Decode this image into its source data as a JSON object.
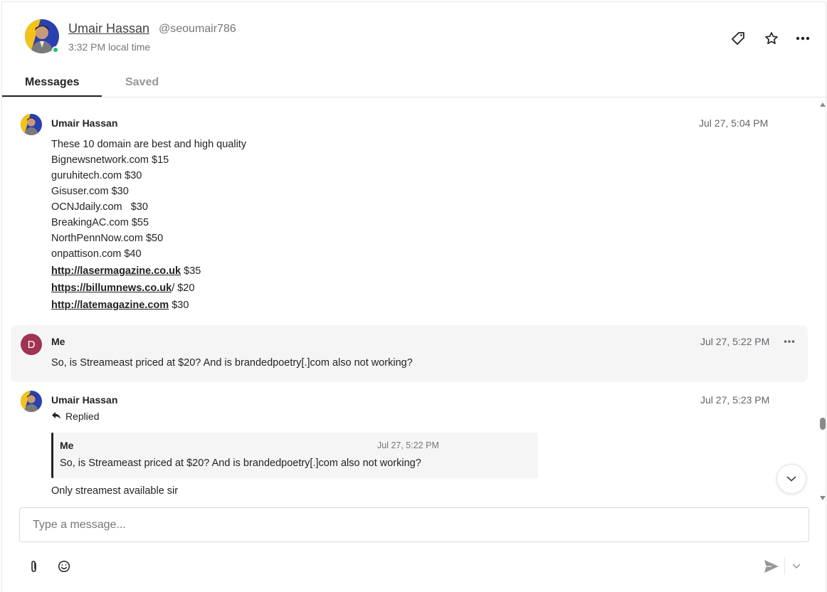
{
  "header": {
    "name": "Umair Hassan",
    "handle": "@seoumair786",
    "local_time": "3:32 PM local time"
  },
  "tabs": [
    {
      "label": "Messages",
      "active": true
    },
    {
      "label": "Saved",
      "active": false
    }
  ],
  "messages": [
    {
      "sender": "Umair Hassan",
      "time": "Jul 27, 5:04 PM",
      "lines": [
        "These 10 domain are best and high quality",
        "Bignewsnetwork.com $15",
        "guruhitech.com $30",
        "Gisuser.com $30",
        "OCNJdaily.com   $30",
        "BreakingAC.com $55",
        "NorthPennNow.com $50",
        "onpattison.com $40"
      ],
      "link_lines": [
        {
          "link": "http://lasermagazine.co.uk",
          "suffix": " $35"
        },
        {
          "link": "https://billumnews.co.uk",
          "suffix": "/ $20"
        },
        {
          "link": "http://latemagazine.com",
          "suffix": " $30"
        }
      ]
    },
    {
      "sender": "Me",
      "avatar_letter": "D",
      "time": "Jul 27, 5:22 PM",
      "text": "So, is Streameast priced at $20? And is brandedpoetry[.]com also not working?"
    },
    {
      "sender": "Umair Hassan",
      "time": "Jul 27, 5:23 PM",
      "replied_label": "Replied",
      "quote": {
        "sender": "Me",
        "time": "Jul 27, 5:22 PM",
        "text": "So, is Streameast priced at $20? And is brandedpoetry[.]com also not working?"
      },
      "text": "Only streamest available sir"
    }
  ],
  "composer": {
    "placeholder": "Type a message..."
  },
  "colors": {
    "online": "#1dbf73",
    "me_avatar": "#9e3452",
    "avatar_bg": "#2a3fb0",
    "avatar_accent": "#f2c318"
  },
  "icons": [
    "tag-icon",
    "star-icon",
    "more-icon",
    "reply-icon",
    "chevron-down-icon",
    "attachment-icon",
    "emoji-icon",
    "send-icon"
  ]
}
